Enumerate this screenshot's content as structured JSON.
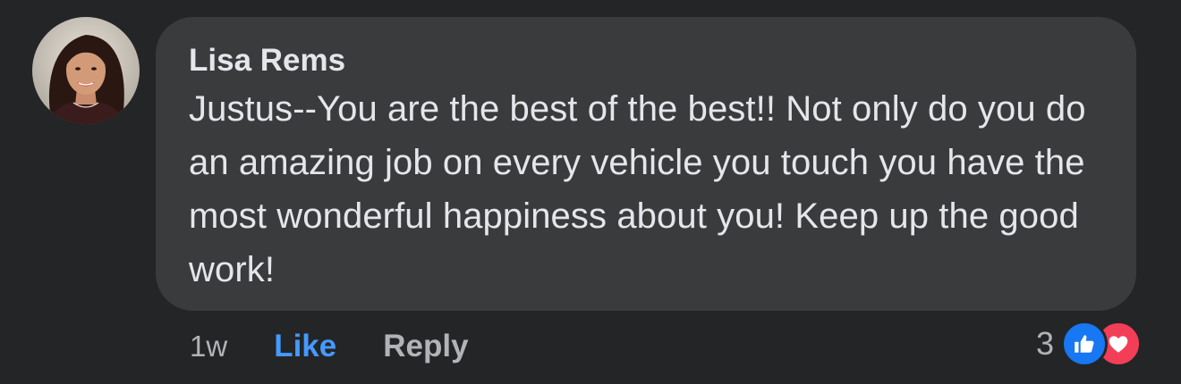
{
  "comment": {
    "author": "Lisa Rems",
    "text": "Justus--You are the best of the best!! Not only do you do an amazing job on every vehicle you touch you have the most wonderful happiness about you! Keep up the good work!",
    "timestamp": "1w",
    "like_label": "Like",
    "reply_label": "Reply",
    "reaction_count": "3",
    "reactions": [
      "like-icon",
      "love-icon"
    ]
  },
  "colors": {
    "background": "#242526",
    "bubble": "#3a3b3c",
    "text": "#e4e6eb",
    "secondary_text": "#b0b3b8",
    "like_blue": "#4599ff",
    "like_badge": "#1877f2",
    "love_badge": "#f33e58"
  }
}
